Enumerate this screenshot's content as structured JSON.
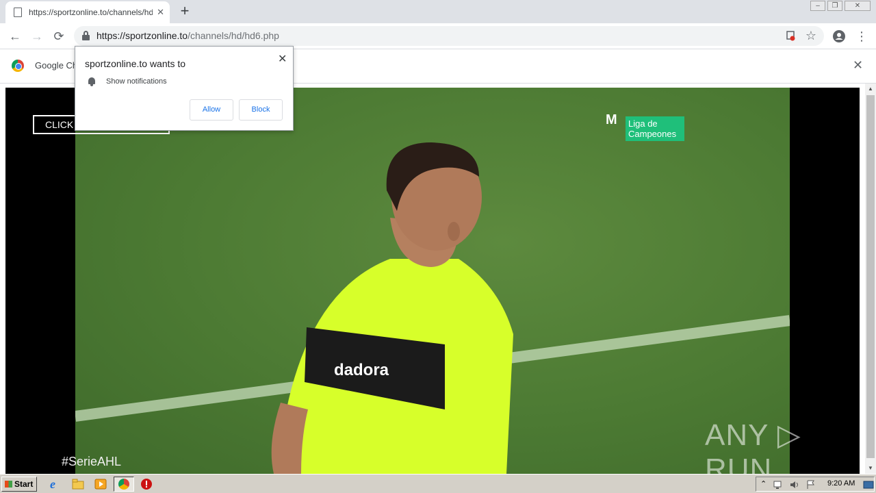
{
  "browser": {
    "tab": {
      "title": "https://sportzonline.to/channels/hd/",
      "close_icon": "close-icon"
    },
    "new_tab_label": "+",
    "window_controls": {
      "minimize": "–",
      "restore": "❐",
      "close": "✕"
    },
    "toolbar": {
      "back_icon": "←",
      "forward_icon": "→",
      "reload_icon": "⟳",
      "url_host": "https://sportzonline.to",
      "url_path": "/channels/hd/hd6.php",
      "star_icon": "☆",
      "more_icon": "⋮"
    },
    "infobar": {
      "text": "Google Ch",
      "close": "✕"
    }
  },
  "permission_popup": {
    "title": "sportzonline.to wants to",
    "permission": "Show notifications",
    "allow_label": "Allow",
    "block_label": "Block",
    "close": "✕"
  },
  "page": {
    "click_button_label": "CLICK",
    "hashtag": "#SerieAHL",
    "brand_logo": "M",
    "brand_label": "Liga de Campeones",
    "watermark": "ANY ▷ RUN"
  },
  "taskbar": {
    "start_label": "Start",
    "clock": "9:20 AM"
  },
  "colors": {
    "accent": "#1a73e8",
    "brand_green": "#1fbf7a",
    "shirt": "#d7ff2a"
  }
}
